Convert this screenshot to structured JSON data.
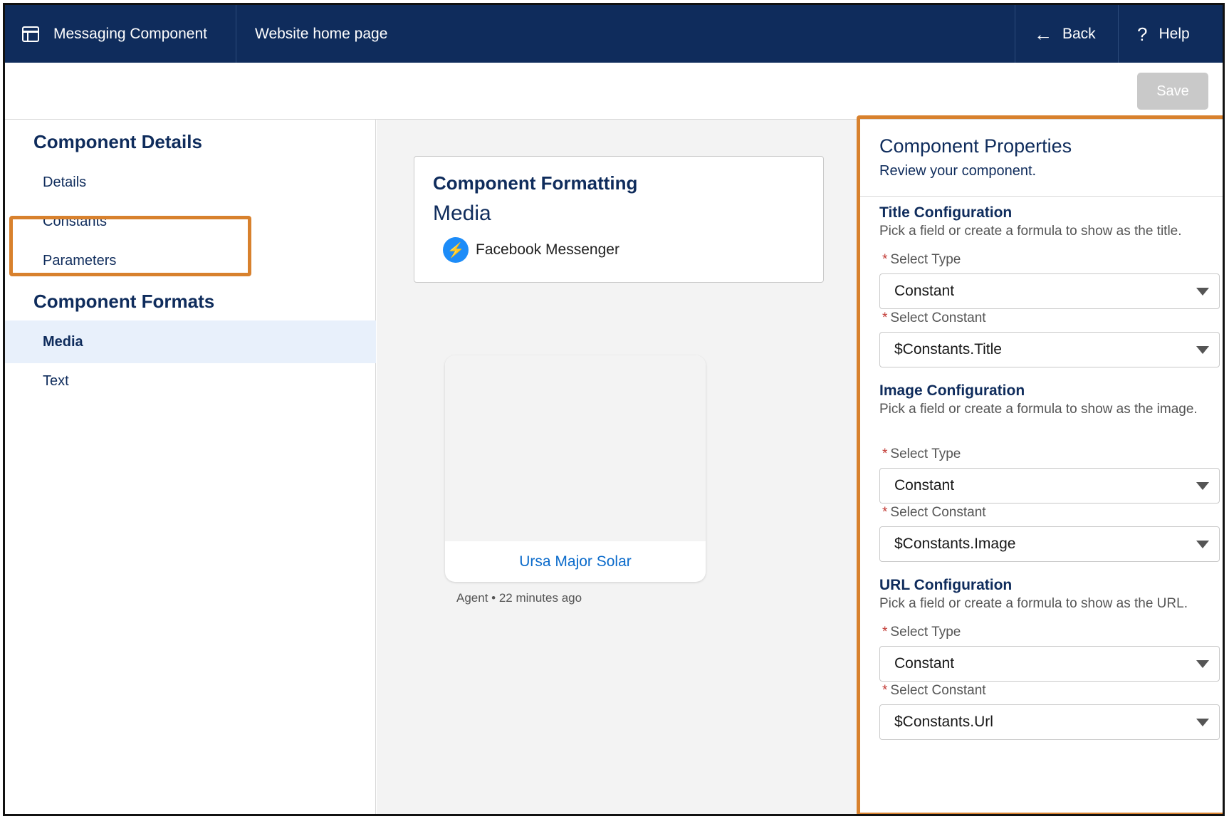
{
  "header": {
    "app_name": "Messaging Component",
    "page_name": "Website home page",
    "back_label": "Back",
    "help_label": "Help"
  },
  "toolbar": {
    "save_label": "Save"
  },
  "sidebar": {
    "section1_title": "Component Details",
    "details_items": [
      "Details",
      "Constants",
      "Parameters"
    ],
    "section2_title": "Component Formats",
    "format_items": [
      "Media",
      "Text"
    ],
    "active_item": "Media"
  },
  "canvas": {
    "formatting_title": "Component Formatting",
    "formatting_subtitle": "Media",
    "channel_name": "Facebook Messenger",
    "media_card_title": "Ursa Major Solar",
    "meta_text": "Agent • 22 minutes ago"
  },
  "properties": {
    "title": "Component Properties",
    "subtitle": "Review your component.",
    "sections": [
      {
        "title": "Title Configuration",
        "description": "Pick a field or create a formula to show as the title.",
        "type_label": "Select Type",
        "type_value": "Constant",
        "constant_label": "Select Constant",
        "constant_value": "$Constants.Title"
      },
      {
        "title": "Image Configuration",
        "description": "Pick a field or create a formula to show as the image.",
        "type_label": "Select Type",
        "type_value": "Constant",
        "constant_label": "Select Constant",
        "constant_value": "$Constants.Image"
      },
      {
        "title": "URL Configuration",
        "description": "Pick a field or create a formula to show as the URL.",
        "type_label": "Select Type",
        "type_value": "Constant",
        "constant_label": "Select Constant",
        "constant_value": "$Constants.Url"
      }
    ]
  },
  "colors": {
    "header_bg": "#0f2c5c",
    "highlight": "#d8812d",
    "active_bg": "#e8f0fb",
    "link": "#0b6bcb"
  },
  "icons": [
    "app-icon",
    "back-arrow-icon",
    "help-icon",
    "messenger-icon",
    "chevron-down-icon"
  ]
}
